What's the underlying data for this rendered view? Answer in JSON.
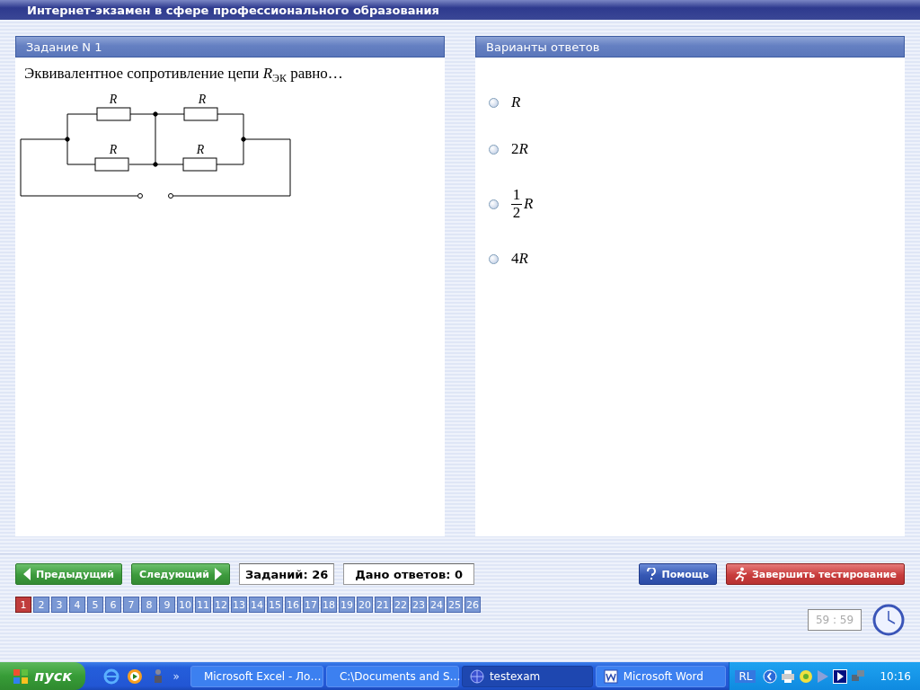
{
  "window": {
    "title": "Интернет-экзамен в сфере профессионального образования"
  },
  "task_panel": {
    "title": "Задание N 1",
    "question": "Эквивалентное сопротивление цепи *R*$_{ЭК}$ равно…",
    "circuit_labels": [
      "R",
      "R",
      "R",
      "R"
    ]
  },
  "answers_panel": {
    "title": "Варианты ответов",
    "options": [
      {
        "kind": "text",
        "symbol": "R",
        "selected": false
      },
      {
        "kind": "text",
        "coefficient": "2",
        "symbol": "R",
        "selected": false
      },
      {
        "kind": "fraction",
        "numerator": "1",
        "denominator": "2",
        "symbol": "R",
        "selected": false
      },
      {
        "kind": "text",
        "coefficient": "4",
        "symbol": "R",
        "selected": false
      }
    ]
  },
  "navigation": {
    "previous": "Предыдущий",
    "next": "Следующий",
    "tasks_count": "Заданий: 26",
    "answers_given": "Дано ответов: 0",
    "help": "Помощь",
    "finish": "Завершить тестирование"
  },
  "pager": [
    {
      "label": "1",
      "selected": true
    },
    {
      "label": "2",
      "selected": false
    },
    {
      "label": "3",
      "selected": false
    },
    {
      "label": "4",
      "selected": false
    },
    {
      "label": "5",
      "selected": false
    },
    {
      "label": "6",
      "selected": false
    },
    {
      "label": "7",
      "selected": false
    },
    {
      "label": "8",
      "selected": false
    },
    {
      "label": "9",
      "selected": false
    },
    {
      "label": "10",
      "selected": false
    },
    {
      "label": "11",
      "selected": false
    },
    {
      "label": "12",
      "selected": false
    },
    {
      "label": "13",
      "selected": false
    },
    {
      "label": "14",
      "selected": false
    },
    {
      "label": "15",
      "selected": false
    },
    {
      "label": "16",
      "selected": false
    },
    {
      "label": "17",
      "selected": false
    },
    {
      "label": "18",
      "selected": false
    },
    {
      "label": "19",
      "selected": false
    },
    {
      "label": "20",
      "selected": false
    },
    {
      "label": "21",
      "selected": false
    },
    {
      "label": "22",
      "selected": false
    },
    {
      "label": "23",
      "selected": false
    },
    {
      "label": "24",
      "selected": false
    },
    {
      "label": "25",
      "selected": false
    },
    {
      "label": "26",
      "selected": false
    }
  ],
  "timer": "59 : 59",
  "taskbar": {
    "start": "пуск",
    "chevron": "»",
    "tasks": [
      {
        "kind": "excel",
        "label": "Microsoft Excel - Ло…",
        "selected": false
      },
      {
        "kind": "folder",
        "label": "C:\\Documents and S…",
        "selected": false
      },
      {
        "kind": "globe",
        "label": "testexam",
        "selected": true
      },
      {
        "kind": "word",
        "label": "Microsoft Word",
        "selected": false
      }
    ],
    "language": "RL",
    "clock": "10:16"
  }
}
